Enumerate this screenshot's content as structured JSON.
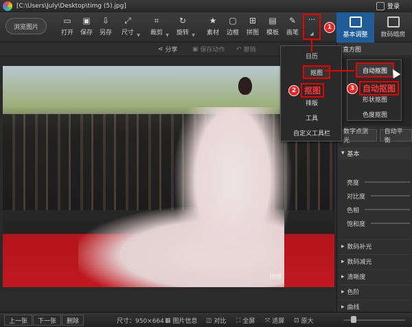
{
  "window": {
    "title": "[C:\\Users\\July\\Desktop\\timg (5).jpg]",
    "login": "登录"
  },
  "toolbar": {
    "browse": "浏览图片",
    "tools": [
      "打开",
      "保存",
      "另存",
      "尺寸",
      "裁剪",
      "旋转",
      "素材",
      "边框",
      "拼图",
      "模板",
      "画笔"
    ],
    "more_icon": "···"
  },
  "right_tabs": {
    "basic": "基本调整",
    "digital": "数码暗房"
  },
  "subbar": {
    "share": "分享",
    "save_action": "保存动作",
    "undo": "撤销"
  },
  "menu": {
    "items": [
      "日历",
      "抠图",
      "排版",
      "工具",
      "自定义工具栏"
    ]
  },
  "submenu": {
    "items": [
      "自动抠图",
      "形状抠图",
      "色度抠图"
    ]
  },
  "callouts": {
    "badge1": "1",
    "badge2": "2",
    "badge3": "3",
    "label2": "抠图",
    "label3": "自动抠图"
  },
  "panel": {
    "histogram": "直方图",
    "btn_fill": "数字点测光",
    "btn_auto": "自动平衡",
    "basic": "基本",
    "sliders": [
      "亮度",
      "对比度",
      "色相",
      "饱和度"
    ],
    "sections": [
      "数码补光",
      "数码减光",
      "清晰度",
      "色阶",
      "曲线"
    ]
  },
  "photo": {
    "watermark": "微博"
  },
  "statusbar": {
    "prev": "上一张",
    "next": "下一张",
    "delete": "删除",
    "size": "尺寸：950×664",
    "info": "图片信息",
    "compare": "对比",
    "fullscreen": "全屏",
    "fit": "适屏",
    "original": "原大"
  }
}
